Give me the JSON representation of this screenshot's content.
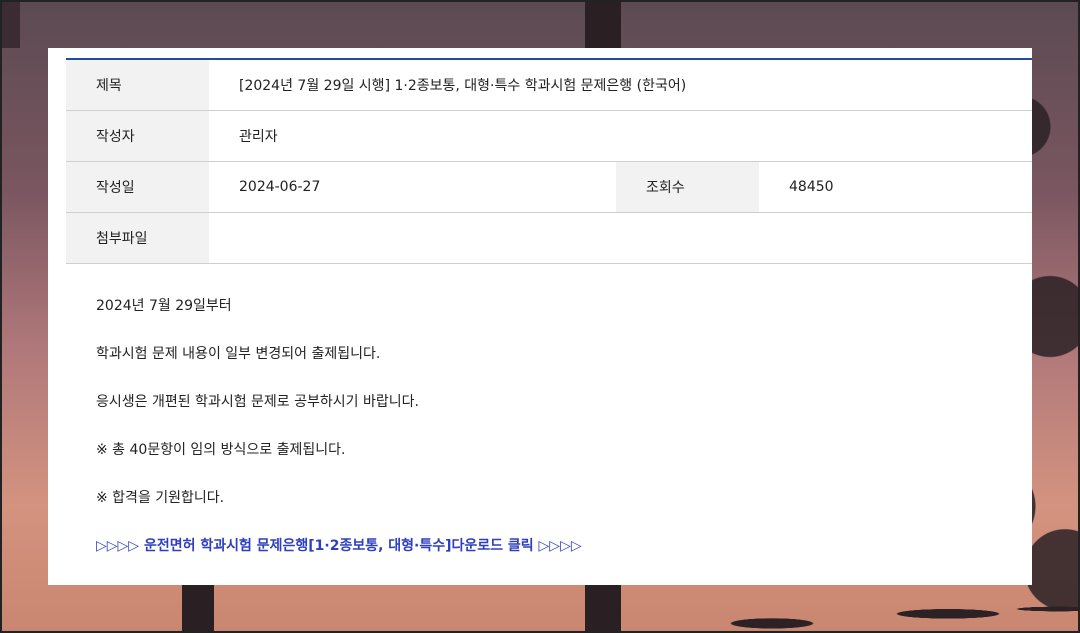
{
  "post": {
    "title_label": "제목",
    "title": "[2024년 7월 29일 시행] 1·2종보통, 대형·특수 학과시험 문제은행 (한국어)",
    "author_label": "작성자",
    "author": "관리자",
    "date_label": "작성일",
    "date": "2024-06-27",
    "views_label": "조회수",
    "views": "48450",
    "attachment_label": "첨부파일",
    "attachment": ""
  },
  "content": {
    "lines": [
      "2024년 7월 29일부터",
      "학과시험 문제 내용이 일부 변경되어 출제됩니다.",
      "응시생은 개편된 학과시험 문제로 공부하시기 바랍니다.",
      "※ 총 40문항이 임의 방식으로 출제됩니다.",
      "※ 합격을 기원합니다."
    ],
    "download_link": "▷▷▷▷ 운전면허 학과시험 문제은행[1·2종보통, 대형·특수]다운로드 클릭 ▷▷▷▷"
  },
  "colors": {
    "accent_border": "#1f4e9c",
    "link": "#2d3fbf",
    "header_cell_bg": "#f2f2f2"
  }
}
